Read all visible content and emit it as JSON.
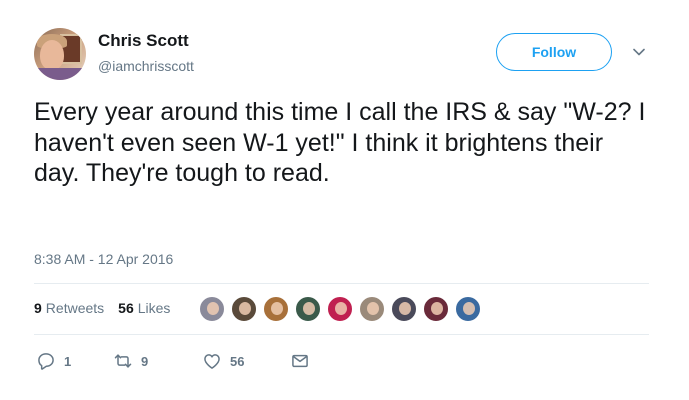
{
  "author": {
    "name": "Chris Scott",
    "handle": "@iamchrisscott"
  },
  "follow_label": "Follow",
  "tweet": {
    "text": "Every year around this time I call the IRS & say \"W-2? I haven't even seen W-1 yet!\" I think it brightens their day. They're tough to read.",
    "timestamp": "8:38 AM - 12 Apr 2016"
  },
  "stats": {
    "retweets_count": "9",
    "retweets_label": "Retweets",
    "likes_count": "56",
    "likes_label": "Likes"
  },
  "likers": [
    {
      "color": "#8a8a9a"
    },
    {
      "color": "#5a4a3a"
    },
    {
      "color": "#a8703a"
    },
    {
      "color": "#3a5a4a"
    },
    {
      "color": "#c02050"
    },
    {
      "color": "#9a8a7a"
    },
    {
      "color": "#4a4a5a"
    },
    {
      "color": "#6a2a3a"
    },
    {
      "color": "#3a6aa0"
    }
  ],
  "actions": {
    "reply_count": "1",
    "retweet_count": "9",
    "like_count": "56"
  },
  "colors": {
    "accent": "#1da1f2",
    "secondary_text": "#657786",
    "divider": "#e6ecf0"
  }
}
